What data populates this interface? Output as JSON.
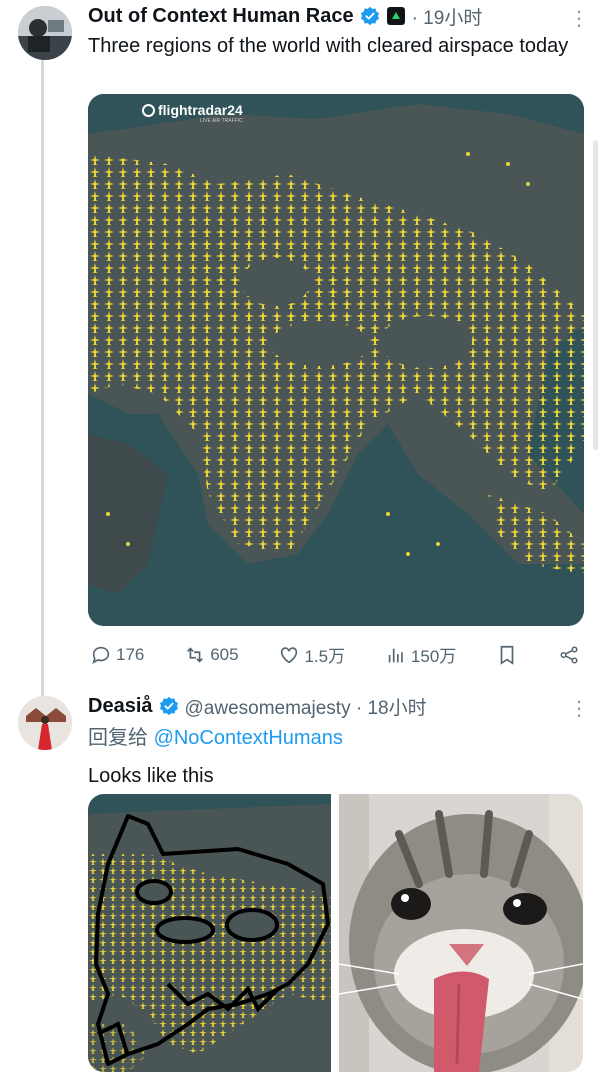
{
  "tweet1": {
    "name": "Out of Context Human Race",
    "time": "· 19小时",
    "text": "Three regions of the world with cleared airspace today",
    "map_watermark": "flightradar24",
    "map_watermark_sub": "LIVE AIR TRAFFIC",
    "stats": {
      "replies": "176",
      "retweets": "605",
      "likes": "1.5万",
      "views": "150万"
    }
  },
  "tweet2": {
    "name": "Deasiå",
    "handle_time": "@awesomemajesty · 18小时",
    "reply_prefix": "回复给",
    "reply_to": "@NoContextHumans",
    "text": "Looks like this"
  },
  "colors": {
    "accent": "#1d9bf0",
    "plane_yellow": "#e9d33a",
    "map_sea": "#2f5358",
    "map_land": "#4a5556",
    "gray_text": "#536471"
  }
}
